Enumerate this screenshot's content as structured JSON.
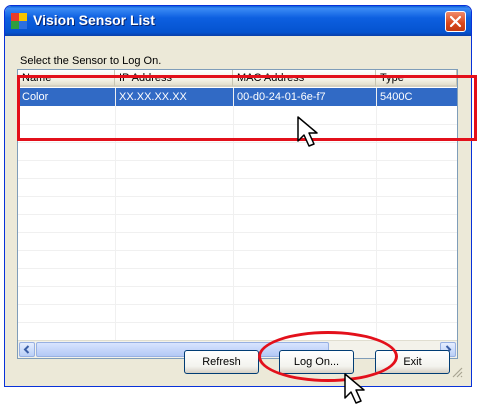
{
  "window": {
    "title": "Vision Sensor List",
    "prompt": "Select the Sensor to Log On."
  },
  "table": {
    "columns": [
      "Name",
      "IP Address",
      "MAC Address",
      "Type"
    ],
    "rows": [
      {
        "name": "Color",
        "ip": "XX.XX.XX.XX",
        "mac": "00-d0-24-01-6e-f7",
        "type": "5400C",
        "selected": true
      }
    ]
  },
  "buttons": {
    "refresh": "Refresh",
    "logon": "Log On...",
    "exit": "Exit"
  },
  "colors": {
    "selection": "#316ac5",
    "annotation": "#e3101b",
    "titlebar": "#0553cf"
  }
}
